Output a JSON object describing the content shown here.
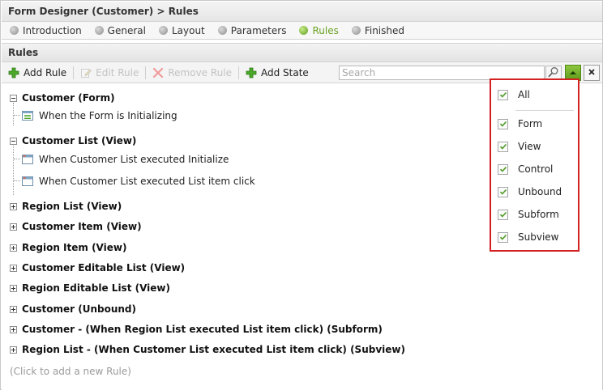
{
  "title": "Form Designer (Customer) > Rules",
  "wizard_steps": [
    {
      "label": "Introduction",
      "active": false
    },
    {
      "label": "General",
      "active": false
    },
    {
      "label": "Layout",
      "active": false
    },
    {
      "label": "Parameters",
      "active": false
    },
    {
      "label": "Rules",
      "active": true
    },
    {
      "label": "Finished",
      "active": false
    }
  ],
  "section_title": "Rules",
  "toolbar": {
    "add_rule": "Add Rule",
    "edit_rule": "Edit Rule",
    "remove_rule": "Remove Rule",
    "add_state": "Add State"
  },
  "search": {
    "placeholder": "Search"
  },
  "tree": [
    {
      "label": "Customer (Form)",
      "expanded": true,
      "children": [
        "When the Form is Initializing"
      ]
    },
    {
      "label": "Customer List (View)",
      "expanded": true,
      "children": [
        "When Customer List executed Initialize",
        "When Customer List executed List item click"
      ]
    },
    {
      "label": "Region List (View)",
      "expanded": false
    },
    {
      "label": "Customer Item (View)",
      "expanded": false
    },
    {
      "label": "Region Item (View)",
      "expanded": false
    },
    {
      "label": "Customer Editable List (View)",
      "expanded": false
    },
    {
      "label": "Region Editable List (View)",
      "expanded": false
    },
    {
      "label": "Customer (Unbound)",
      "expanded": false
    },
    {
      "label": "Customer - (When Region List executed List item click) (Subform)",
      "expanded": false
    },
    {
      "label": "Region List - (When Customer List executed List item click) (Subview)",
      "expanded": false
    }
  ],
  "add_new_rule": "(Click to add a new Rule)",
  "filter_options": [
    {
      "label": "All",
      "checked": true
    },
    {
      "label": "Form",
      "checked": true
    },
    {
      "label": "View",
      "checked": true
    },
    {
      "label": "Control",
      "checked": true
    },
    {
      "label": "Unbound",
      "checked": true
    },
    {
      "label": "Subform",
      "checked": true
    },
    {
      "label": "Subview",
      "checked": true
    }
  ],
  "colors": {
    "accent": "#6aa121",
    "highlight_border": "#d42020"
  }
}
